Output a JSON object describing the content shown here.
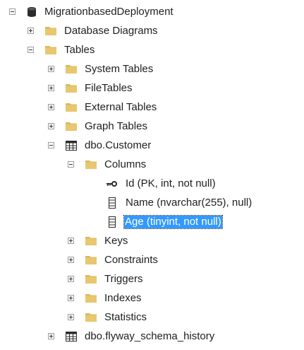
{
  "tree": {
    "database": "MigrationbasedDeployment",
    "database_diagrams": "Database Diagrams",
    "tables": "Tables",
    "system_tables": "System Tables",
    "file_tables": "FileTables",
    "external_tables": "External Tables",
    "graph_tables": "Graph Tables",
    "customer_table": "dbo.Customer",
    "columns": "Columns",
    "col_id": "Id (PK, int, not null)",
    "col_name": "Name (nvarchar(255), null)",
    "col_age": "Age (tinyint, not null)",
    "keys": "Keys",
    "constraints": "Constraints",
    "triggers": "Triggers",
    "indexes": "Indexes",
    "statistics": "Statistics",
    "flyway_table": "dbo.flyway_schema_history"
  },
  "colors": {
    "folder": "#dcb85c",
    "selection": "#3399ff",
    "expander_border": "#9c9c9c"
  },
  "icons": {
    "database": "database-icon",
    "folder": "folder-icon",
    "table": "table-icon",
    "primary_key": "key-icon",
    "column": "column-icon"
  }
}
